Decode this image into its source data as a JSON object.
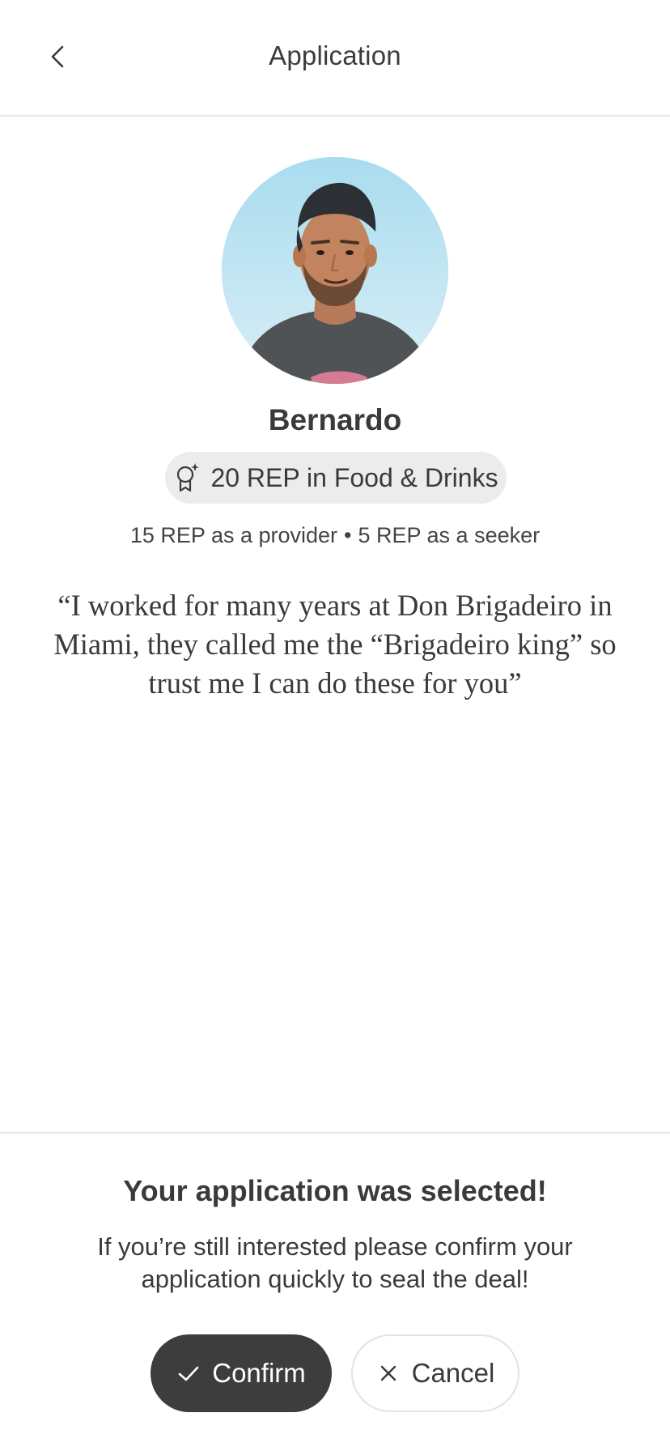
{
  "header": {
    "title": "Application",
    "back_icon": "chevron-left-icon"
  },
  "profile": {
    "name": "Bernardo",
    "rep_badge": {
      "icon": "award-badge-icon",
      "label": "20 REP in Food & Drinks"
    },
    "rep_provider": "15 REP as a provider",
    "rep_separator": "•",
    "rep_seeker": "5 REP as a seeker",
    "quote": "“I worked for many years at Don Brigadeiro in Miami, they called me the “Brigadeiro king” so trust me I can do these for you”"
  },
  "selection": {
    "title": "Your application was selected!",
    "message": "If you’re still interested please confirm your application quickly to seal the deal!",
    "confirm_label": "Confirm",
    "confirm_icon": "checkmark-icon",
    "cancel_label": "Cancel",
    "cancel_icon": "close-icon"
  },
  "colors": {
    "primary_button": "#3d3d3d",
    "pill_background": "#ececec",
    "divider": "#e6e6e6"
  }
}
